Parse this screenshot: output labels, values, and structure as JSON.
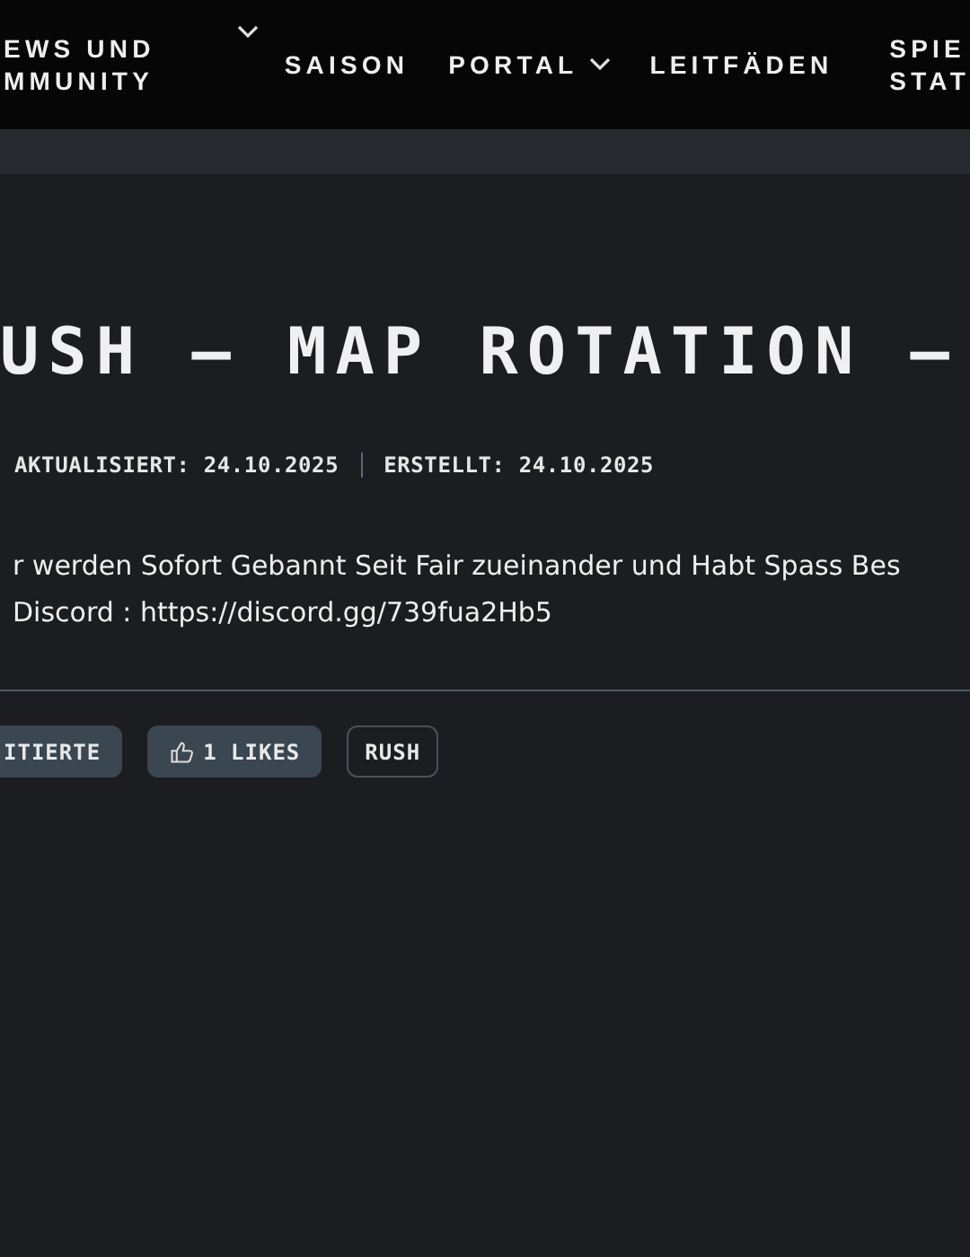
{
  "nav": [
    {
      "lines": [
        "EWS UND",
        "MMUNITY"
      ],
      "dropdown": true
    },
    {
      "lines": [
        "SAISON"
      ],
      "dropdown": false
    },
    {
      "lines": [
        "PORTAL"
      ],
      "dropdown": true
    },
    {
      "lines": [
        "LEITFÄDEN"
      ],
      "dropdown": false
    },
    {
      "lines": [
        "SPIE",
        "STAT"
      ],
      "dropdown": false
    }
  ],
  "title": "USH – MAP ROTATION –",
  "meta": [
    "AKTUALISIERT: 24.10.2025",
    "ERSTELLT: 24.10.2025"
  ],
  "body": [
    "r werden Sofort Gebannt Seit Fair zueinander und Habt Spass Bes",
    "Discord : https://discord.gg/739fua2Hb5"
  ],
  "actions": [
    {
      "kind": "filled",
      "label": "ITIERTE"
    },
    {
      "kind": "like",
      "label": "1 LIKES"
    },
    {
      "kind": "tag",
      "label": "RUSH"
    }
  ]
}
